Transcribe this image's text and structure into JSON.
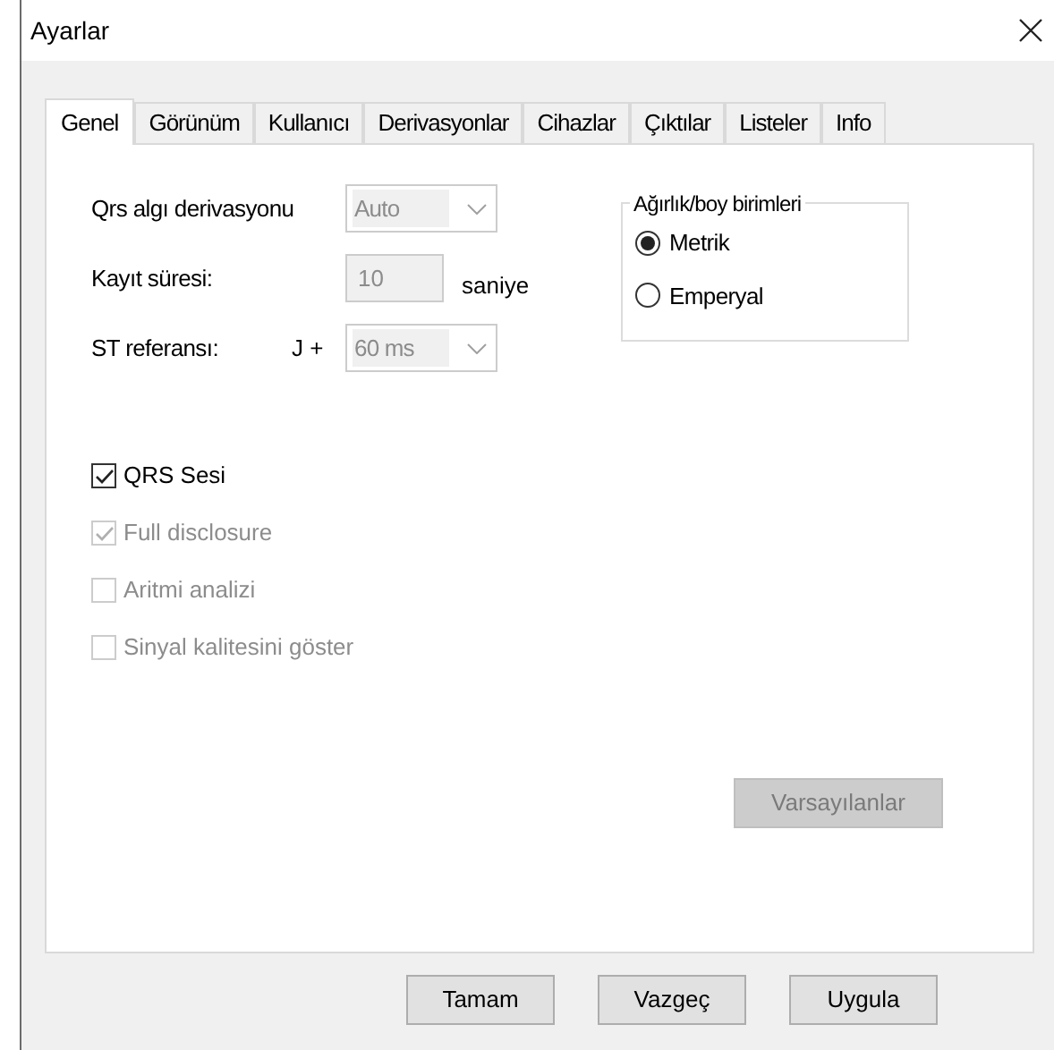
{
  "window": {
    "title": "Ayarlar"
  },
  "tabs": [
    {
      "label": "Genel",
      "selected": true
    },
    {
      "label": "Görünüm",
      "selected": false
    },
    {
      "label": "Kullanıcı",
      "selected": false
    },
    {
      "label": "Derivasyonlar",
      "selected": false
    },
    {
      "label": "Cihazlar",
      "selected": false
    },
    {
      "label": "Çıktılar",
      "selected": false
    },
    {
      "label": "Listeler",
      "selected": false
    },
    {
      "label": "Info",
      "selected": false
    }
  ],
  "settings": [
    {
      "kind": "combo",
      "label": "Qrs algı derivasyonu",
      "value": "Auto",
      "disabled": true
    },
    {
      "kind": "text",
      "label": "Kayıt süresi:",
      "value": "10",
      "unit": "saniye",
      "disabled": true
    },
    {
      "kind": "combo",
      "label": "ST referansı:",
      "prefix": "J +",
      "value": "60 ms",
      "disabled": true
    }
  ],
  "units_group": {
    "title": "Ağırlık/boy birimleri",
    "options": [
      {
        "label": "Metrik",
        "selected": true
      },
      {
        "label": "Emperyal",
        "selected": false
      }
    ]
  },
  "checkboxes": [
    {
      "label": "QRS Sesi",
      "checked": true,
      "disabled": false
    },
    {
      "label": "Full disclosure",
      "checked": true,
      "disabled": true
    },
    {
      "label": "Aritmi analizi",
      "checked": false,
      "disabled": true
    },
    {
      "label": "Sinyal kalitesini göster",
      "checked": false,
      "disabled": true
    }
  ],
  "defaults_button": {
    "label": "Varsayılanlar",
    "disabled": true
  },
  "buttons": [
    "Tamam",
    "Vazgeç",
    "Uygula"
  ]
}
